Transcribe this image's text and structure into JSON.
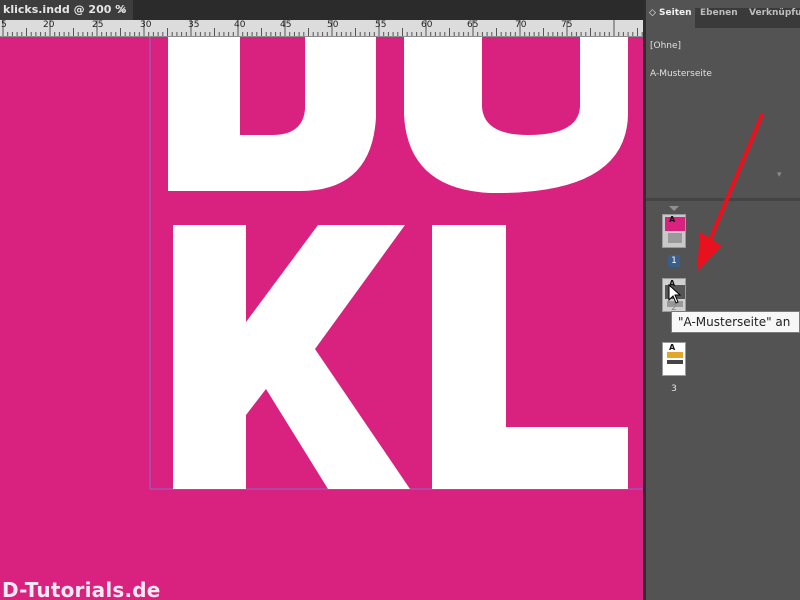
{
  "document": {
    "tab_label": "klicks.indd @ 200 %",
    "close_glyph": "×"
  },
  "ruler": {
    "labels": [
      "5",
      "20",
      "25",
      "30",
      "35",
      "40",
      "45",
      "50",
      "55",
      "60",
      "65",
      "70",
      "75"
    ]
  },
  "canvas": {
    "background_color": "#d9217f",
    "letters": [
      "D",
      "O",
      "K",
      "L"
    ],
    "watermark": "D-Tutorials.de"
  },
  "panel": {
    "tabs": [
      {
        "label": "◇ Seiten",
        "active": true
      },
      {
        "label": "Ebenen",
        "active": false
      },
      {
        "label": "Verknüpfun",
        "active": false
      }
    ],
    "masters": {
      "none_label": "[Ohne]",
      "a_label": "A-Musterseite"
    },
    "pages": [
      {
        "number": "1",
        "master_prefix": "A"
      },
      {
        "number": "2",
        "master_prefix": "A"
      },
      {
        "number": "3",
        "master_prefix": "A"
      }
    ],
    "tooltip": "\"A-Musterseite\" an"
  },
  "colors": {
    "accent_arrow": "#e8121f",
    "panel_bg": "#535353"
  }
}
